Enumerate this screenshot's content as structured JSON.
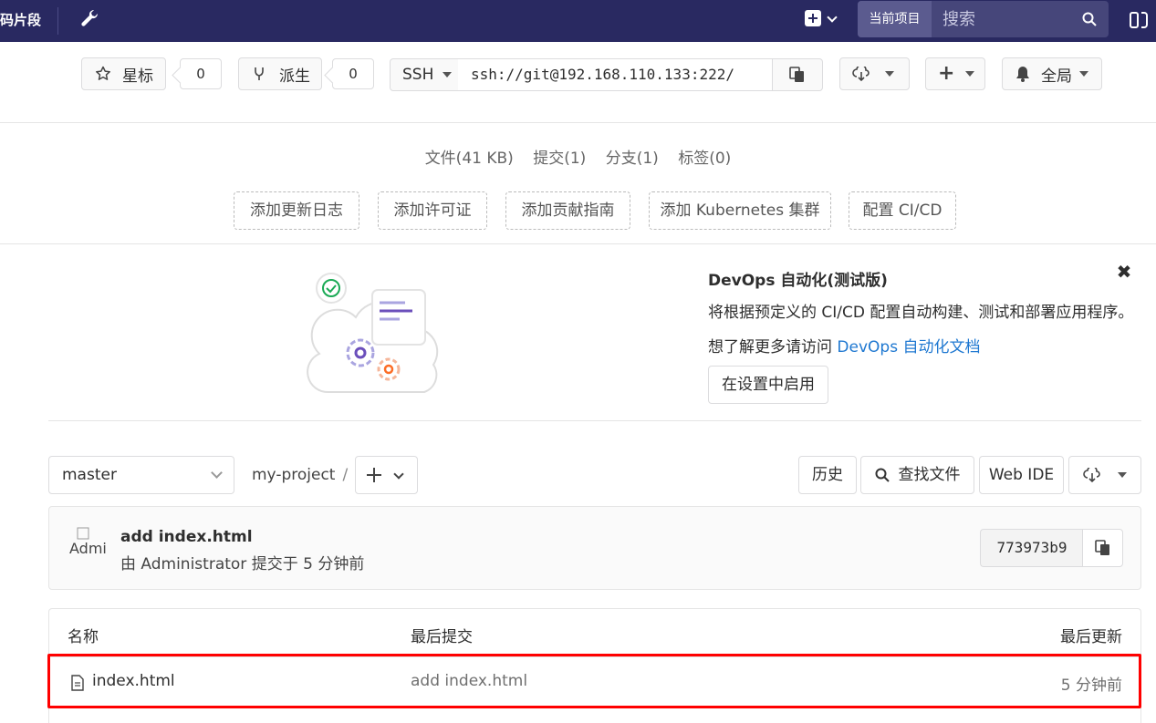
{
  "topnav": {
    "snippets_label": "码片段",
    "search_scope": "当前项目",
    "search_placeholder": "搜索"
  },
  "project_actions": {
    "star_label": "星标",
    "star_count": "0",
    "fork_label": "派生",
    "fork_count": "0",
    "clone_protocol": "SSH",
    "clone_url": "ssh://git@192.168.110.133:222/",
    "notification_label": "全局"
  },
  "stats": {
    "files": "文件(41 KB)",
    "commits": "提交(1)",
    "branches": "分支(1)",
    "tags": "标签(0)"
  },
  "quick_actions": [
    "添加更新日志",
    "添加许可证",
    "添加贡献指南",
    "添加 Kubernetes 集群",
    "配置 CI/CD"
  ],
  "devops": {
    "title": "DevOps 自动化(测试版)",
    "description": "将根据预定义的 CI/CD 配置自动构建、测试和部署应用程序。",
    "more_prefix": "想了解更多请访问 ",
    "more_link": "DevOps 自动化文档",
    "enable_label": "在设置中启用",
    "close_glyph": "✖"
  },
  "tree": {
    "branch": "master",
    "project": "my-project",
    "separator": "/",
    "history_label": "历史",
    "find_file_label": "查找文件",
    "web_ide_label": "Web IDE"
  },
  "commit": {
    "avatar_alt": "Admi",
    "title": "add index.html",
    "meta": "由 Administrator 提交于 5 分钟前",
    "sha": "773973b9"
  },
  "table": {
    "headers": [
      "名称",
      "最后提交",
      "最后更新"
    ],
    "rows": [
      {
        "name": "index.html",
        "last_commit": "add index.html",
        "updated": "5 分钟前"
      }
    ]
  },
  "colors": {
    "nav_bg": "#292961",
    "link": "#1f78d1",
    "highlight": "#ff0000"
  }
}
